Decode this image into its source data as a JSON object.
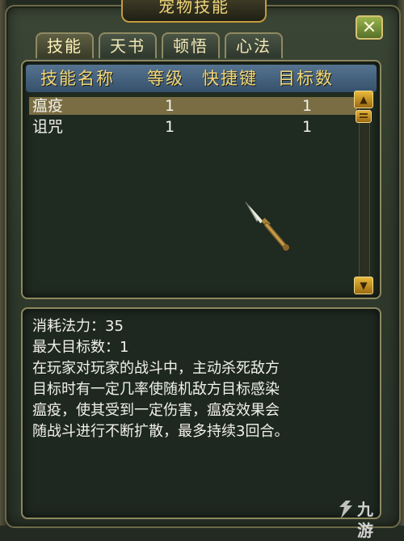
{
  "window": {
    "title": "宠物技能",
    "close_label": "✕"
  },
  "tabs": [
    {
      "label": "技能",
      "active": true
    },
    {
      "label": "天书",
      "active": false
    },
    {
      "label": "顿悟",
      "active": false
    },
    {
      "label": "心法",
      "active": false
    }
  ],
  "skill_table": {
    "headers": [
      "技能名称",
      "等级",
      "快捷键",
      "目标数"
    ],
    "rows": [
      {
        "name": "瘟疫",
        "level": "1",
        "hotkey": "",
        "targets": "1",
        "selected": true
      },
      {
        "name": "诅咒",
        "level": "1",
        "hotkey": "",
        "targets": "1",
        "selected": false
      }
    ]
  },
  "description": {
    "lines": [
      "消耗法力：35",
      "最大目标数：1",
      "在玩家对玩家的战斗中，主动杀死敌方",
      "目标时有一定几率使随机敌方目标感染",
      "瘟疫，使其受到一定伤害，瘟疫效果会",
      "随战斗进行不断扩散，最多持续3回合。"
    ]
  },
  "watermark": {
    "text": "九游"
  },
  "colors": {
    "header_bg": "#45627f",
    "header_text": "#f3d879",
    "selected_row": "#7a6d43",
    "gold_button": "#e8b93a",
    "close_button": "#7f9a3c"
  }
}
